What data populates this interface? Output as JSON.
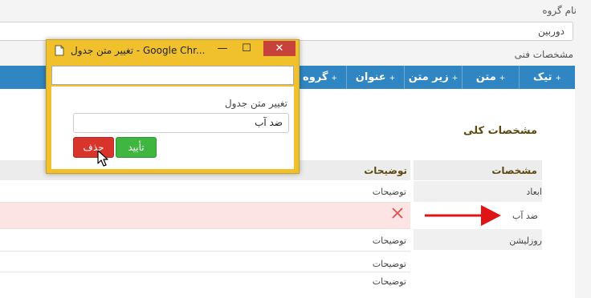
{
  "form": {
    "group_name_label": "نام گروه",
    "group_name_value": "دوربین",
    "tech_specs_label": "مشخصات فنی"
  },
  "toolbar": {
    "plus": "+",
    "buttons": [
      "تیک",
      "متن",
      "زیر متن",
      "عنوان",
      "گروه"
    ]
  },
  "section": {
    "heading": "مشخصات کلی"
  },
  "table": {
    "headers": {
      "spec": "مشخصات",
      "desc": "توضیحات"
    },
    "rows": [
      {
        "spec": "ابعاد",
        "desc": "توضیحات"
      },
      {
        "spec": "ضد آب",
        "desc": ""
      },
      {
        "spec": "روزلیشن",
        "desc": "توضیحات"
      },
      {
        "spec": "",
        "desc": "توضیحات"
      },
      {
        "spec": "",
        "desc": "توضیحات"
      }
    ]
  },
  "popup": {
    "window_title": "تغییر متن جدول - Google Chr...",
    "minimize": "—",
    "maximize": "☐",
    "close": "✕",
    "label": "تغییر متن جدول",
    "input_value": "ضد آب",
    "confirm_label": "تأیید",
    "delete_label": "حذف"
  },
  "colors": {
    "toolbar": "#2f86c2",
    "popup_frame": "#f0c12d",
    "delete": "#d9342b",
    "confirm": "#3fb63f",
    "highlight_row": "#fce4e4",
    "arrow": "#e01414"
  }
}
